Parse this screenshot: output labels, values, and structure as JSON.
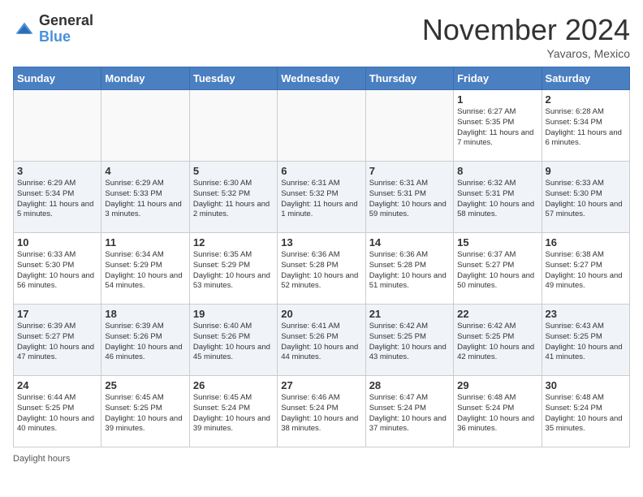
{
  "logo": {
    "general": "General",
    "blue": "Blue"
  },
  "title": "November 2024",
  "location": "Yavaros, Mexico",
  "days_of_week": [
    "Sunday",
    "Monday",
    "Tuesday",
    "Wednesday",
    "Thursday",
    "Friday",
    "Saturday"
  ],
  "footer": "Daylight hours",
  "weeks": [
    [
      {
        "day": "",
        "info": ""
      },
      {
        "day": "",
        "info": ""
      },
      {
        "day": "",
        "info": ""
      },
      {
        "day": "",
        "info": ""
      },
      {
        "day": "",
        "info": ""
      },
      {
        "day": "1",
        "info": "Sunrise: 6:27 AM\nSunset: 5:35 PM\nDaylight: 11 hours and 7 minutes."
      },
      {
        "day": "2",
        "info": "Sunrise: 6:28 AM\nSunset: 5:34 PM\nDaylight: 11 hours and 6 minutes."
      }
    ],
    [
      {
        "day": "3",
        "info": "Sunrise: 6:29 AM\nSunset: 5:34 PM\nDaylight: 11 hours and 5 minutes."
      },
      {
        "day": "4",
        "info": "Sunrise: 6:29 AM\nSunset: 5:33 PM\nDaylight: 11 hours and 3 minutes."
      },
      {
        "day": "5",
        "info": "Sunrise: 6:30 AM\nSunset: 5:32 PM\nDaylight: 11 hours and 2 minutes."
      },
      {
        "day": "6",
        "info": "Sunrise: 6:31 AM\nSunset: 5:32 PM\nDaylight: 11 hours and 1 minute."
      },
      {
        "day": "7",
        "info": "Sunrise: 6:31 AM\nSunset: 5:31 PM\nDaylight: 10 hours and 59 minutes."
      },
      {
        "day": "8",
        "info": "Sunrise: 6:32 AM\nSunset: 5:31 PM\nDaylight: 10 hours and 58 minutes."
      },
      {
        "day": "9",
        "info": "Sunrise: 6:33 AM\nSunset: 5:30 PM\nDaylight: 10 hours and 57 minutes."
      }
    ],
    [
      {
        "day": "10",
        "info": "Sunrise: 6:33 AM\nSunset: 5:30 PM\nDaylight: 10 hours and 56 minutes."
      },
      {
        "day": "11",
        "info": "Sunrise: 6:34 AM\nSunset: 5:29 PM\nDaylight: 10 hours and 54 minutes."
      },
      {
        "day": "12",
        "info": "Sunrise: 6:35 AM\nSunset: 5:29 PM\nDaylight: 10 hours and 53 minutes."
      },
      {
        "day": "13",
        "info": "Sunrise: 6:36 AM\nSunset: 5:28 PM\nDaylight: 10 hours and 52 minutes."
      },
      {
        "day": "14",
        "info": "Sunrise: 6:36 AM\nSunset: 5:28 PM\nDaylight: 10 hours and 51 minutes."
      },
      {
        "day": "15",
        "info": "Sunrise: 6:37 AM\nSunset: 5:27 PM\nDaylight: 10 hours and 50 minutes."
      },
      {
        "day": "16",
        "info": "Sunrise: 6:38 AM\nSunset: 5:27 PM\nDaylight: 10 hours and 49 minutes."
      }
    ],
    [
      {
        "day": "17",
        "info": "Sunrise: 6:39 AM\nSunset: 5:27 PM\nDaylight: 10 hours and 47 minutes."
      },
      {
        "day": "18",
        "info": "Sunrise: 6:39 AM\nSunset: 5:26 PM\nDaylight: 10 hours and 46 minutes."
      },
      {
        "day": "19",
        "info": "Sunrise: 6:40 AM\nSunset: 5:26 PM\nDaylight: 10 hours and 45 minutes."
      },
      {
        "day": "20",
        "info": "Sunrise: 6:41 AM\nSunset: 5:26 PM\nDaylight: 10 hours and 44 minutes."
      },
      {
        "day": "21",
        "info": "Sunrise: 6:42 AM\nSunset: 5:25 PM\nDaylight: 10 hours and 43 minutes."
      },
      {
        "day": "22",
        "info": "Sunrise: 6:42 AM\nSunset: 5:25 PM\nDaylight: 10 hours and 42 minutes."
      },
      {
        "day": "23",
        "info": "Sunrise: 6:43 AM\nSunset: 5:25 PM\nDaylight: 10 hours and 41 minutes."
      }
    ],
    [
      {
        "day": "24",
        "info": "Sunrise: 6:44 AM\nSunset: 5:25 PM\nDaylight: 10 hours and 40 minutes."
      },
      {
        "day": "25",
        "info": "Sunrise: 6:45 AM\nSunset: 5:25 PM\nDaylight: 10 hours and 39 minutes."
      },
      {
        "day": "26",
        "info": "Sunrise: 6:45 AM\nSunset: 5:24 PM\nDaylight: 10 hours and 39 minutes."
      },
      {
        "day": "27",
        "info": "Sunrise: 6:46 AM\nSunset: 5:24 PM\nDaylight: 10 hours and 38 minutes."
      },
      {
        "day": "28",
        "info": "Sunrise: 6:47 AM\nSunset: 5:24 PM\nDaylight: 10 hours and 37 minutes."
      },
      {
        "day": "29",
        "info": "Sunrise: 6:48 AM\nSunset: 5:24 PM\nDaylight: 10 hours and 36 minutes."
      },
      {
        "day": "30",
        "info": "Sunrise: 6:48 AM\nSunset: 5:24 PM\nDaylight: 10 hours and 35 minutes."
      }
    ]
  ]
}
